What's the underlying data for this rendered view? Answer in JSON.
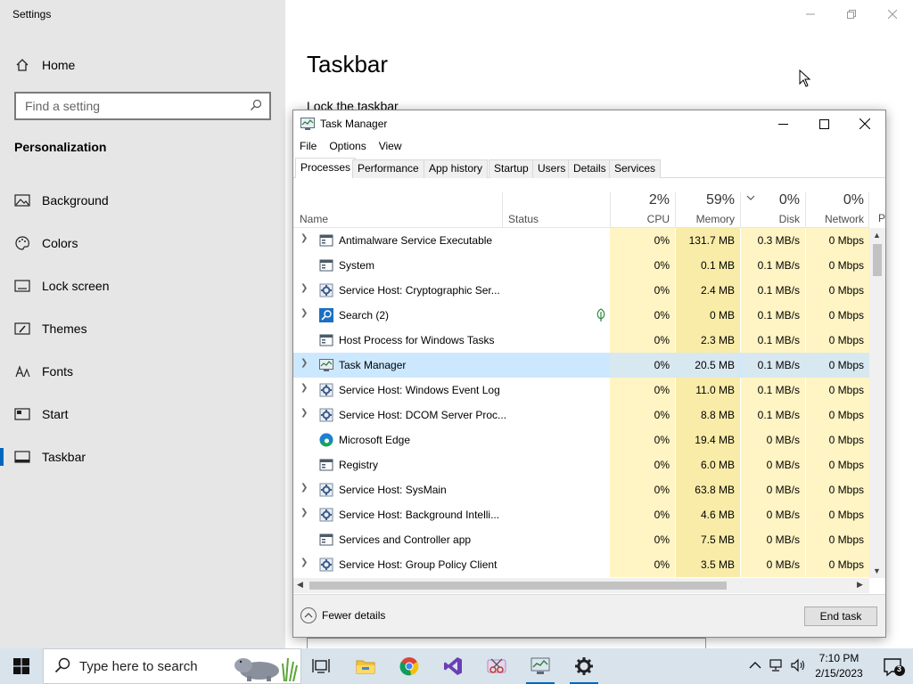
{
  "settings": {
    "window_title": "Settings",
    "home_label": "Home",
    "search_placeholder": "Find a setting",
    "section_title": "Personalization",
    "nav": [
      {
        "label": "Background",
        "icon": "picture-icon"
      },
      {
        "label": "Colors",
        "icon": "palette-icon"
      },
      {
        "label": "Lock screen",
        "icon": "lock-screen-icon"
      },
      {
        "label": "Themes",
        "icon": "brush-icon"
      },
      {
        "label": "Fonts",
        "icon": "font-icon"
      },
      {
        "label": "Start",
        "icon": "start-icon"
      },
      {
        "label": "Taskbar",
        "icon": "taskbar-icon",
        "active": true
      }
    ],
    "page_title": "Taskbar",
    "lock_taskbar_label": "Lock the taskbar"
  },
  "task_manager": {
    "title": "Task Manager",
    "menu": [
      "File",
      "Options",
      "View"
    ],
    "tabs": [
      "Processes",
      "Performance",
      "App history",
      "Startup",
      "Users",
      "Details",
      "Services"
    ],
    "active_tab": "Processes",
    "columns": {
      "name": "Name",
      "status": "Status",
      "cpu": {
        "pct": "2%",
        "label": "CPU"
      },
      "memory": {
        "pct": "59%",
        "label": "Memory"
      },
      "disk": {
        "pct": "0%",
        "label": "Disk"
      },
      "network": {
        "pct": "0%",
        "label": "Network"
      },
      "power_partial": "P"
    },
    "processes": [
      {
        "name": "Antimalware Service Executable",
        "expandable": true,
        "icon": "window-icon",
        "cpu": "0%",
        "memory": "131.7 MB",
        "disk": "0.3 MB/s",
        "network": "0 Mbps"
      },
      {
        "name": "System",
        "expandable": false,
        "icon": "window-icon",
        "cpu": "0%",
        "memory": "0.1 MB",
        "disk": "0.1 MB/s",
        "network": "0 Mbps"
      },
      {
        "name": "Service Host: Cryptographic Ser...",
        "expandable": true,
        "icon": "gear-icon",
        "cpu": "0%",
        "memory": "2.4 MB",
        "disk": "0.1 MB/s",
        "network": "0 Mbps"
      },
      {
        "name": "Search (2)",
        "expandable": true,
        "icon": "search-icon",
        "cpu": "0%",
        "memory": "0 MB",
        "disk": "0.1 MB/s",
        "network": "0 Mbps",
        "suspended": true
      },
      {
        "name": "Host Process for Windows Tasks",
        "expandable": false,
        "icon": "window-icon",
        "cpu": "0%",
        "memory": "2.3 MB",
        "disk": "0.1 MB/s",
        "network": "0 Mbps"
      },
      {
        "name": "Task Manager",
        "expandable": true,
        "icon": "task-manager-icon",
        "cpu": "0%",
        "memory": "20.5 MB",
        "disk": "0.1 MB/s",
        "network": "0 Mbps",
        "selected": true
      },
      {
        "name": "Service Host: Windows Event Log",
        "expandable": true,
        "icon": "gear-icon",
        "cpu": "0%",
        "memory": "11.0 MB",
        "disk": "0.1 MB/s",
        "network": "0 Mbps"
      },
      {
        "name": "Service Host: DCOM Server Proc...",
        "expandable": true,
        "icon": "gear-icon",
        "cpu": "0%",
        "memory": "8.8 MB",
        "disk": "0.1 MB/s",
        "network": "0 Mbps"
      },
      {
        "name": "Microsoft Edge",
        "expandable": false,
        "icon": "edge-icon",
        "cpu": "0%",
        "memory": "19.4 MB",
        "disk": "0 MB/s",
        "network": "0 Mbps"
      },
      {
        "name": "Registry",
        "expandable": false,
        "icon": "window-icon",
        "cpu": "0%",
        "memory": "6.0 MB",
        "disk": "0 MB/s",
        "network": "0 Mbps"
      },
      {
        "name": "Service Host: SysMain",
        "expandable": true,
        "icon": "gear-icon",
        "cpu": "0%",
        "memory": "63.8 MB",
        "disk": "0 MB/s",
        "network": "0 Mbps"
      },
      {
        "name": "Service Host: Background Intelli...",
        "expandable": true,
        "icon": "gear-icon",
        "cpu": "0%",
        "memory": "4.6 MB",
        "disk": "0 MB/s",
        "network": "0 Mbps"
      },
      {
        "name": "Services and Controller app",
        "expandable": false,
        "icon": "window-icon",
        "cpu": "0%",
        "memory": "7.5 MB",
        "disk": "0 MB/s",
        "network": "0 Mbps"
      },
      {
        "name": "Service Host: Group Policy Client",
        "expandable": true,
        "icon": "gear-icon",
        "cpu": "0%",
        "memory": "3.5 MB",
        "disk": "0 MB/s",
        "network": "0 Mbps"
      }
    ],
    "fewer_details": "Fewer details",
    "end_task": "End task"
  },
  "taskbar": {
    "search_text": "Type here to search",
    "apps": [
      "task-view-icon",
      "file-explorer-icon",
      "chrome-icon",
      "visual-studio-icon",
      "snipping-tool-icon",
      "task-manager-icon",
      "settings-icon"
    ],
    "time": "7:10 PM",
    "date": "2/15/2023",
    "notification_count": "3"
  },
  "colors": {
    "accent": "#0067c0",
    "heat_light": "#fff4c4",
    "heat_medium": "#f9eca8",
    "selection": "#cce8ff"
  }
}
